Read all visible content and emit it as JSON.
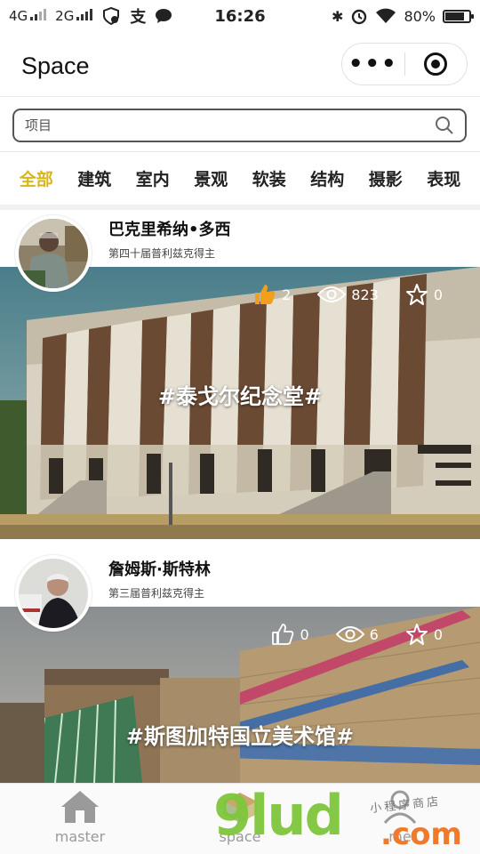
{
  "status_bar": {
    "network_1": "4G",
    "network_2": "2G",
    "time": "16:26",
    "battery": "80%",
    "battery_level": 0.8
  },
  "titlebar": {
    "title": "Space"
  },
  "search": {
    "placeholder": "项目"
  },
  "tabs": [
    {
      "label": "全部",
      "active": true
    },
    {
      "label": "建筑",
      "active": false
    },
    {
      "label": "室内",
      "active": false
    },
    {
      "label": "景观",
      "active": false
    },
    {
      "label": "软装",
      "active": false
    },
    {
      "label": "结构",
      "active": false
    },
    {
      "label": "摄影",
      "active": false
    },
    {
      "label": "表现",
      "active": false
    }
  ],
  "cards": [
    {
      "name": "巴克里希纳•多西",
      "subtitle": "第四十届普利兹克得主",
      "likes": "2",
      "views": "823",
      "favorites": "0",
      "liked": true,
      "tagline": "#泰戈尔纪念堂#"
    },
    {
      "name": "詹姆斯·斯特林",
      "subtitle": "第三届普利兹克得主",
      "likes": "0",
      "views": "6",
      "favorites": "0",
      "liked": false,
      "tagline": "#斯图加特国立美术馆#"
    }
  ],
  "bottom_nav": [
    {
      "label": "master",
      "icon": "home-icon"
    },
    {
      "label": "space",
      "icon": "space-icon"
    },
    {
      "label": "me",
      "icon": "user-icon"
    }
  ],
  "watermark": {
    "main": "9lud",
    "suffix": ".com",
    "small": "小程序商店"
  },
  "colors": {
    "active_tab": "#d9b51c",
    "like_active": "#f2a01c",
    "watermark_green": "#7ec63c",
    "watermark_orange": "#f07a2c"
  }
}
